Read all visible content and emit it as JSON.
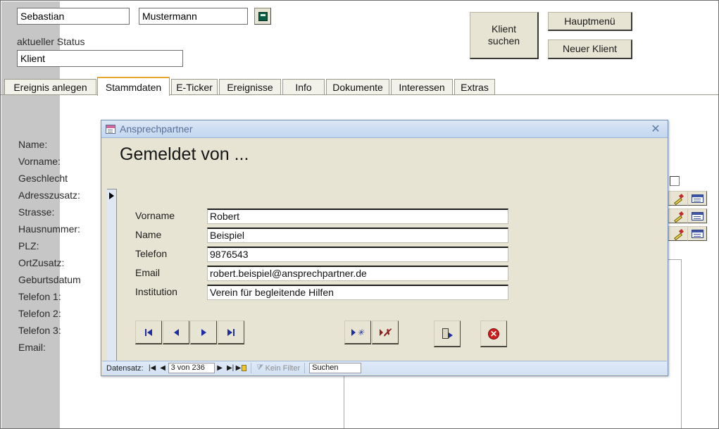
{
  "header": {
    "firstname_value": "Sebastian",
    "lastname_value": "Mustermann",
    "status_label": "aktueller Status",
    "status_value": "Klient",
    "record_icon": "green-card-icon",
    "buttons": {
      "klient_suchen": "Klient\nsuchen",
      "klient_suchen_line1": "Klient",
      "klient_suchen_line2": "suchen",
      "hauptmenue": "Hauptmenü",
      "neuer_klient": "Neuer Klient"
    }
  },
  "tabs": [
    {
      "label": "Ereignis anlegen",
      "active": false
    },
    {
      "label": "Stammdaten",
      "active": true
    },
    {
      "label": "E-Ticker",
      "active": false
    },
    {
      "label": "Ereignisse",
      "active": false
    },
    {
      "label": "Info",
      "active": false
    },
    {
      "label": "Dokumente",
      "active": false
    },
    {
      "label": "Interessen",
      "active": false
    },
    {
      "label": "Extras",
      "active": false
    }
  ],
  "sidebar": {
    "labels": [
      "Name:",
      "Vorname:",
      "Geschlecht",
      "Adresszusatz:",
      "Strasse:",
      "Hausnummer:",
      "PLZ:",
      "OrtZusatz:",
      "Geburtsdatum",
      "Telefon 1:",
      "Telefon 2:",
      "Telefon 3:",
      "Email:"
    ]
  },
  "dialog": {
    "title": "Ansprechpartner",
    "title_icon": "form-icon",
    "close_label": "✕",
    "heading": "Gemeldet von ...",
    "fields": [
      {
        "label": "Vorname",
        "value": "Robert"
      },
      {
        "label": "Name",
        "value": "Beispiel"
      },
      {
        "label": "Telefon",
        "value": "9876543"
      },
      {
        "label": "Email",
        "value": "robert.beispiel@ansprechpartner.de"
      },
      {
        "label": "Institution",
        "value": "Verein für begleitende Hilfen"
      }
    ],
    "nav_buttons": [
      {
        "name": "first-record-button"
      },
      {
        "name": "previous-record-button"
      },
      {
        "name": "next-record-button"
      },
      {
        "name": "last-record-button"
      }
    ],
    "action_buttons": [
      {
        "name": "new-record-button"
      },
      {
        "name": "delete-record-button"
      },
      {
        "name": "exit-button"
      },
      {
        "name": "close-button"
      }
    ],
    "statusbar": {
      "record_label": "Datensatz:",
      "record_position": "3 von 236",
      "filter_label": "Kein Filter",
      "search_value": "Suchen"
    }
  },
  "right_controls": {
    "checkbox_checked": false,
    "rows": [
      {
        "edit_icon": "pencil-icon",
        "mail_icon": "envelope-icon"
      },
      {
        "edit_icon": "pencil-icon",
        "mail_icon": "envelope-icon"
      },
      {
        "edit_icon": "pencil-icon",
        "mail_icon": "envelope-icon"
      }
    ]
  },
  "colors": {
    "dialog_bg": "#e8e4d4",
    "titlebar": "#cfdff2",
    "sidebar": "#c6c6c6",
    "tab_accent": "#e8a72c",
    "button_face": "#e8e4d4"
  }
}
